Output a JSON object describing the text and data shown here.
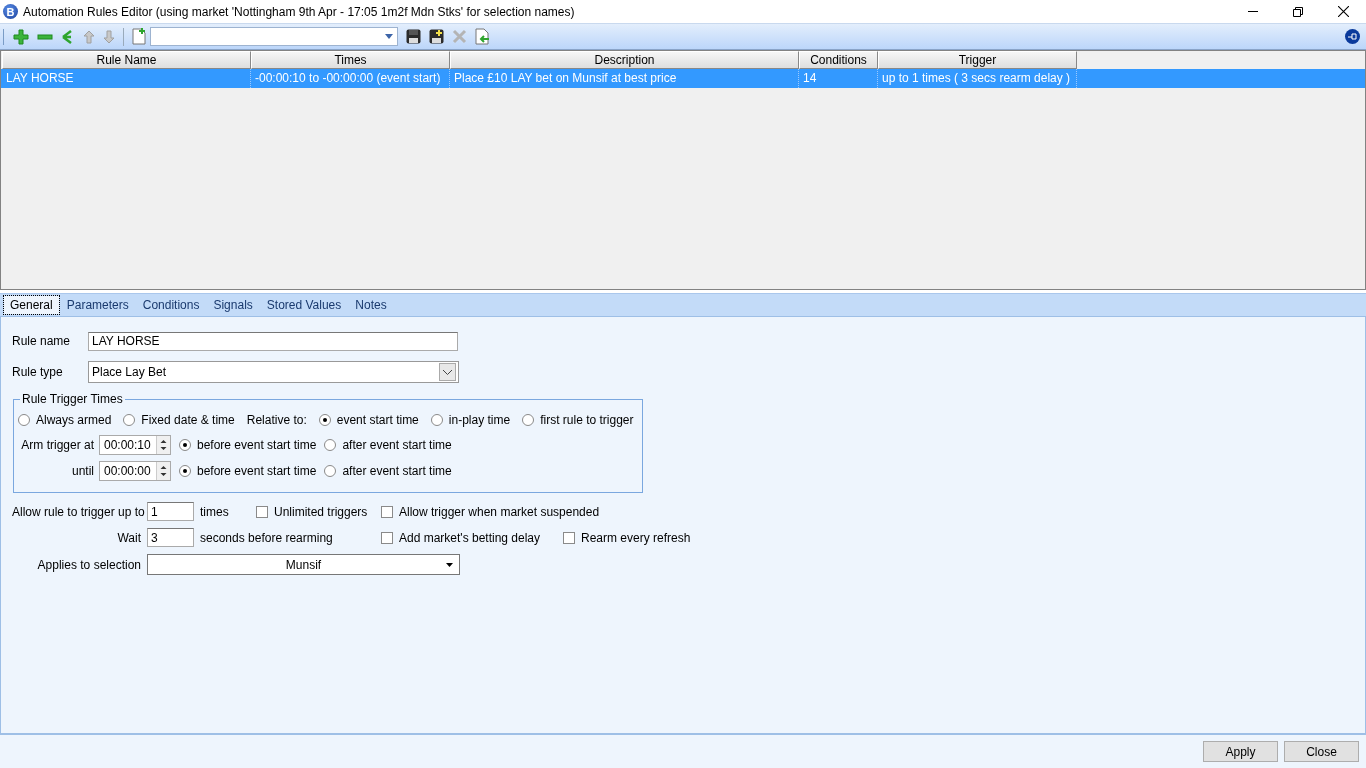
{
  "window": {
    "title": "Automation Rules Editor (using market 'Nottingham 9th Apr - 17:05 1m2f Mdn Stks' for selection names)",
    "app_icon_letter": "B"
  },
  "table": {
    "columns": [
      "Rule Name",
      "Times",
      "Description",
      "Conditions",
      "Trigger"
    ],
    "rows": [
      {
        "selected": true,
        "cells": [
          "LAY HORSE",
          "-00:00:10 to -00:00:00 (event start)",
          "Place £10 LAY bet on Munsif at best price",
          "14",
          "up to 1 times ( 3 secs rearm delay )"
        ]
      }
    ]
  },
  "tabs": [
    {
      "label": "General",
      "selected": true
    },
    {
      "label": "Parameters",
      "selected": false
    },
    {
      "label": "Conditions",
      "selected": false
    },
    {
      "label": "Signals",
      "selected": false
    },
    {
      "label": "Stored Values",
      "selected": false
    },
    {
      "label": "Notes",
      "selected": false
    }
  ],
  "general": {
    "rule_name": {
      "label": "Rule name",
      "value": "LAY HORSE"
    },
    "rule_type": {
      "label": "Rule type",
      "value": "Place Lay Bet"
    },
    "trigger_times": {
      "title": "Rule Trigger Times",
      "modes": [
        {
          "label": "Always armed",
          "selected": false
        },
        {
          "label": "Fixed date & time",
          "selected": false
        }
      ],
      "relative_label": "Relative to:",
      "relative_options": [
        {
          "label": "event start time",
          "selected": true
        },
        {
          "label": "in-play time",
          "selected": false
        },
        {
          "label": "first rule to trigger",
          "selected": false
        }
      ],
      "arm": {
        "label": "Arm trigger at",
        "value": "00:00:10",
        "options": [
          {
            "label": "before event start time",
            "selected": true
          },
          {
            "label": "after event start time",
            "selected": false
          }
        ]
      },
      "until": {
        "label": "until",
        "value": "00:00:00",
        "options": [
          {
            "label": "before event start time",
            "selected": true
          },
          {
            "label": "after event start time",
            "selected": false
          }
        ]
      }
    },
    "trigger_limit": {
      "label": "Allow rule to trigger up to",
      "value": "1",
      "suffix": "times"
    },
    "unlimited": {
      "label": "Unlimited triggers",
      "checked": false
    },
    "allow_suspended": {
      "label": "Allow trigger when market suspended",
      "checked": false
    },
    "wait": {
      "label": "Wait",
      "value": "3",
      "suffix": "seconds before rearming"
    },
    "betting_delay": {
      "label": "Add market's betting delay",
      "checked": false
    },
    "rearm_refresh": {
      "label": "Rearm every refresh",
      "checked": false
    },
    "selection": {
      "label": "Applies to selection",
      "value": "Munsif"
    }
  },
  "buttons": [
    "Apply",
    "Close"
  ]
}
